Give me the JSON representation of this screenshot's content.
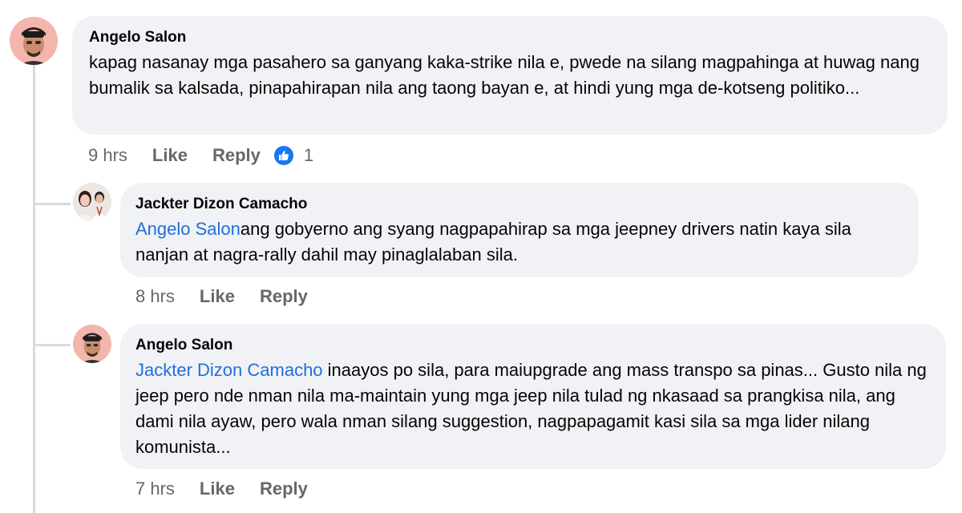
{
  "comments": [
    {
      "author": "Angelo Salon",
      "text": "kapag nasanay mga pasahero sa ganyang kaka-strike nila e, pwede na silang magpahinga at huwag nang bumalik sa kalsada, pinapahirapan nila ang taong bayan e, at hindi yung mga de-kotseng politiko...",
      "time": "9 hrs",
      "like_label": "Like",
      "reply_label": "Reply",
      "reaction_icon": "like-reaction-icon",
      "reaction_count": "1"
    },
    {
      "author": "Jackter Dizon Camacho",
      "mention": "Angelo Salon",
      "text": "ang gobyerno ang syang nagpapahirap sa mga jeepney drivers natin kaya sila nanjan at nagra-rally dahil may pinaglalaban sila.",
      "time": "8 hrs",
      "like_label": "Like",
      "reply_label": "Reply"
    },
    {
      "author": "Angelo Salon",
      "mention": "Jackter Dizon Camacho",
      "text": " inaayos po sila, para maiupgrade ang mass transpo sa pinas... Gusto nila ng jeep pero nde nman nila ma-maintain yung mga jeep nila tulad ng nkasaad sa prangkisa nila, ang dami nila ayaw, pero wala nman silang suggestion, nagpapagamit kasi sila sa mga lider nilang komunista...",
      "time": "7 hrs",
      "like_label": "Like",
      "reply_label": "Reply"
    }
  ],
  "colors": {
    "bubble": "#f0f2f5",
    "mention": "#216fdb",
    "muted": "#65676b",
    "like_blue": "#1877f2"
  }
}
